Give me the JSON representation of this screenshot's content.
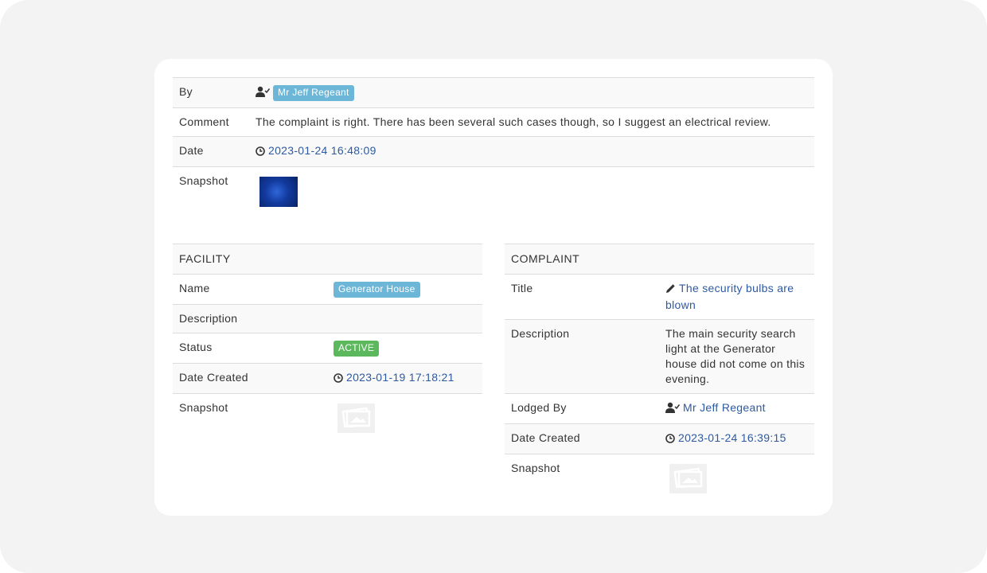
{
  "comment_block": {
    "by_label": "By",
    "by_value": "Mr Jeff Regeant",
    "comment_label": "Comment",
    "comment_value": "The complaint is right. There has been several such cases though, so I suggest an electrical review.",
    "date_label": "Date",
    "date_value": "2023-01-24 16:48:09",
    "snapshot_label": "Snapshot"
  },
  "facility": {
    "header": "FACILITY",
    "name_label": "Name",
    "name_value": "Generator House",
    "description_label": "Description",
    "status_label": "Status",
    "status_value": "ACTIVE",
    "date_created_label": "Date Created",
    "date_created_value": "2023-01-19 17:18:21",
    "snapshot_label": "Snapshot"
  },
  "complaint": {
    "header": "COMPLAINT",
    "title_label": "Title",
    "title_value": "The security bulbs are blown",
    "description_label": "Description",
    "description_value": "The main security search light at the Generator house did not come on this evening.",
    "lodged_by_label": "Lodged By",
    "lodged_by_value": "Mr Jeff Regeant",
    "date_created_label": "Date Created",
    "date_created_value": "2023-01-24 16:39:15",
    "snapshot_label": "Snapshot"
  },
  "colors": {
    "info_badge": "#6cb7d8",
    "success_badge": "#5cb85c",
    "link": "#2d5aa0"
  },
  "icons": {
    "user_check": "user-check-icon",
    "clock": "clock-icon",
    "pencil": "pencil-icon",
    "image_placeholder": "image-placeholder-icon"
  }
}
